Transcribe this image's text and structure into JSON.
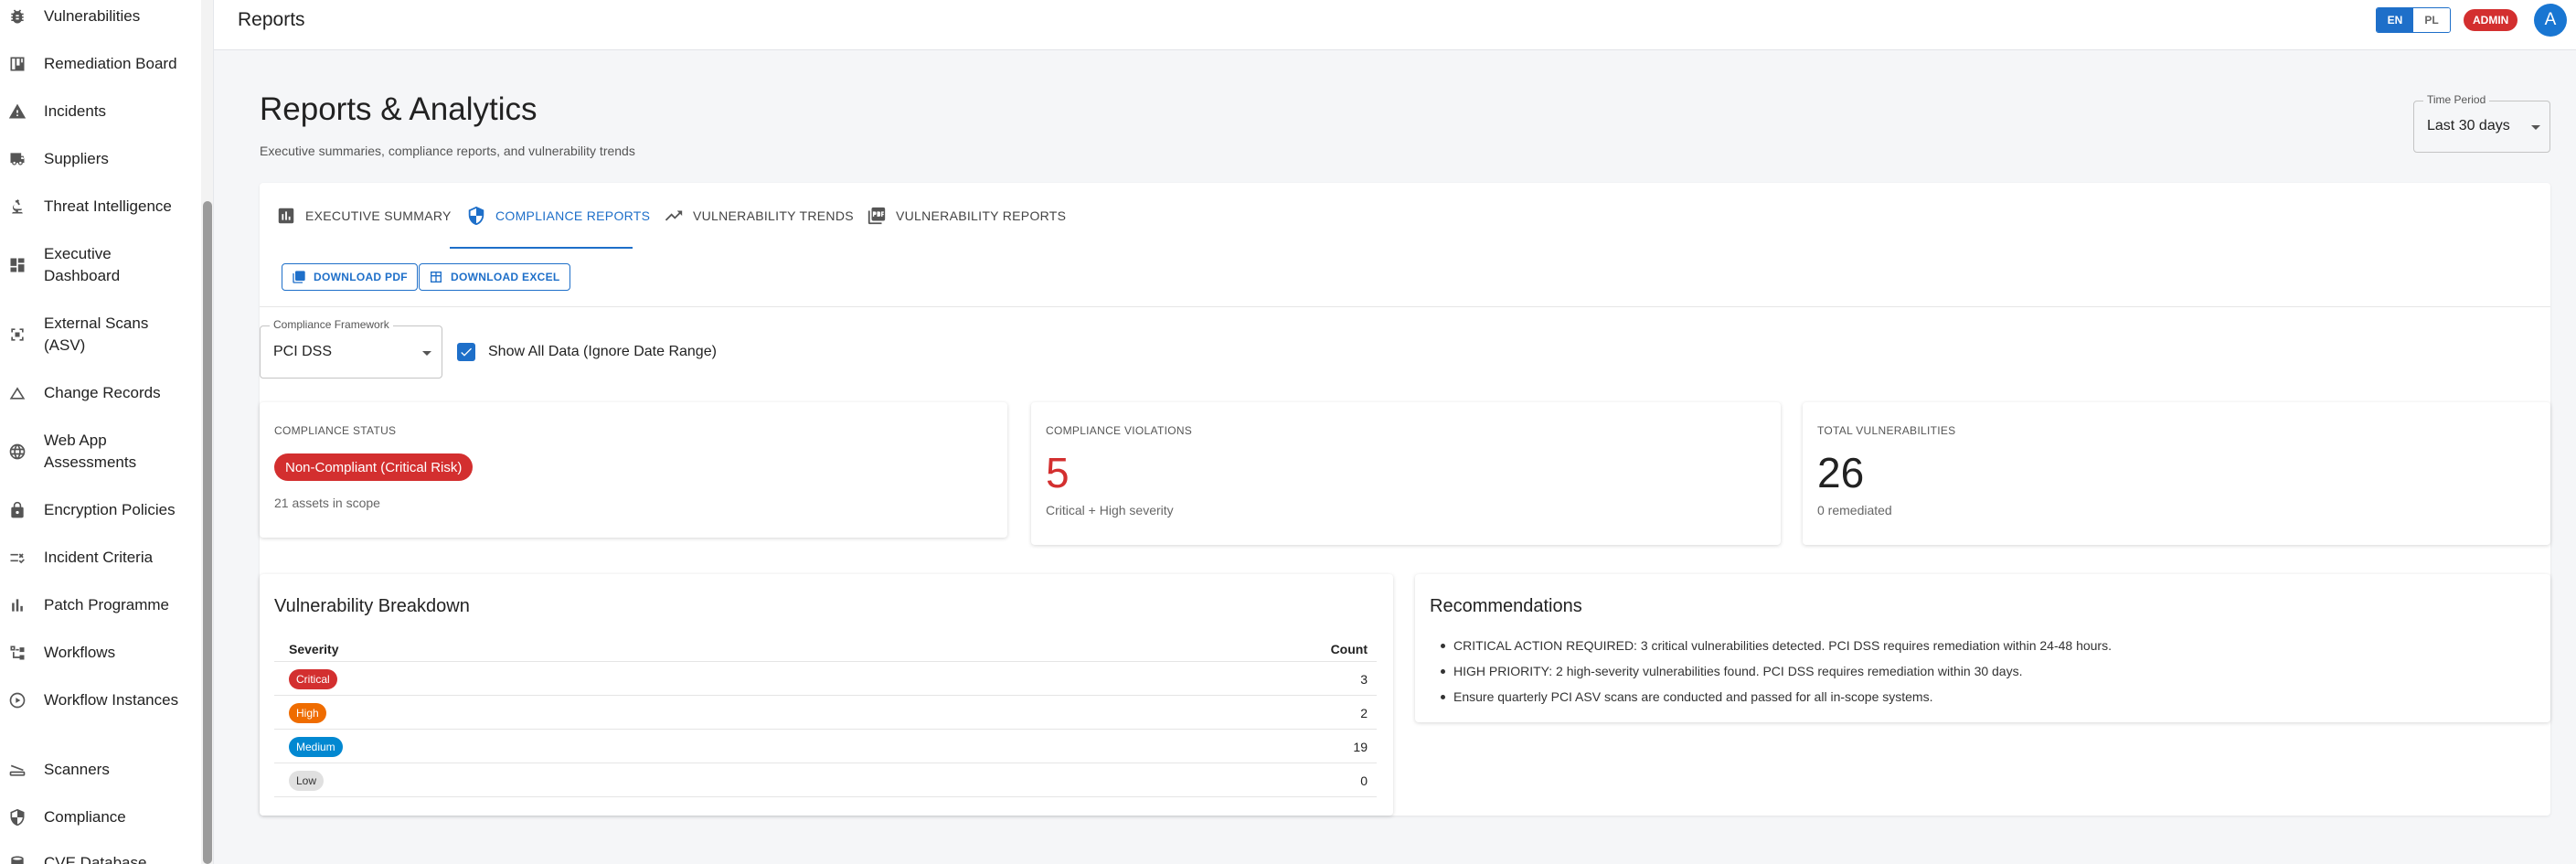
{
  "sidebar": {
    "items": [
      {
        "label": "Vulnerabilities",
        "icon": "bug-icon"
      },
      {
        "label": "Remediation Board",
        "icon": "board-icon"
      },
      {
        "label": "Incidents",
        "icon": "warning-icon"
      },
      {
        "label": "Suppliers",
        "icon": "truck-icon"
      },
      {
        "label": "Threat Intelligence",
        "icon": "microscope-icon"
      },
      {
        "label": "Executive Dashboard",
        "icon": "dashboard-icon"
      },
      {
        "label": "External Scans (ASV)",
        "icon": "radar-icon"
      },
      {
        "label": "Change Records",
        "icon": "triangle-icon"
      },
      {
        "label": "Web App Assessments",
        "icon": "globe-icon"
      },
      {
        "label": "Encryption Policies",
        "icon": "lock-icon"
      },
      {
        "label": "Incident Criteria",
        "icon": "rule-icon"
      },
      {
        "label": "Patch Programme",
        "icon": "bar-chart-icon"
      },
      {
        "label": "Workflows",
        "icon": "workflow-icon"
      },
      {
        "label": "Workflow Instances",
        "icon": "play-circle-icon"
      },
      {
        "label": "Scanners",
        "icon": "scanner-icon"
      },
      {
        "label": "Compliance",
        "icon": "shield-icon"
      },
      {
        "label": "CVE Database",
        "icon": "database-icon"
      }
    ]
  },
  "topbar": {
    "title": "Reports",
    "lang_en": "EN",
    "lang_pl": "PL",
    "role_badge": "ADMIN",
    "avatar_letter": "A"
  },
  "page": {
    "title": "Reports & Analytics",
    "subtitle": "Executive summaries, compliance reports, and vulnerability trends",
    "time_period_label": "Time Period",
    "time_period_value": "Last 30 days"
  },
  "tabs": [
    {
      "label": "EXECUTIVE SUMMARY",
      "icon": "bar-chart-icon",
      "active": false
    },
    {
      "label": "COMPLIANCE REPORTS",
      "icon": "shield-icon",
      "active": true
    },
    {
      "label": "VULNERABILITY TRENDS",
      "icon": "trending-up-icon",
      "active": false
    },
    {
      "label": "VULNERABILITY REPORTS",
      "icon": "pdf-icon",
      "active": false
    }
  ],
  "actions": {
    "download_pdf": "DOWNLOAD PDF",
    "download_excel": "DOWNLOAD EXCEL"
  },
  "filters": {
    "framework_label": "Compliance Framework",
    "framework_value": "PCI DSS",
    "show_all_label": "Show All Data (Ignore Date Range)",
    "show_all_checked": true
  },
  "stats": {
    "compliance_status": {
      "label": "COMPLIANCE STATUS",
      "status": "Non-Compliant (Critical Risk)",
      "sub": "21 assets in scope"
    },
    "violations": {
      "label": "COMPLIANCE VIOLATIONS",
      "value": "5",
      "sub": "Critical + High severity"
    },
    "total_vulns": {
      "label": "TOTAL VULNERABILITIES",
      "value": "26",
      "sub": "0 remediated"
    }
  },
  "breakdown": {
    "title": "Vulnerability Breakdown",
    "col_severity": "Severity",
    "col_count": "Count",
    "rows": [
      {
        "severity": "Critical",
        "count": "3",
        "color": "#d32f2f",
        "text_color": "#ffffff"
      },
      {
        "severity": "High",
        "count": "2",
        "color": "#ef6c00",
        "text_color": "#ffffff"
      },
      {
        "severity": "Medium",
        "count": "19",
        "color": "#0288d1",
        "text_color": "#ffffff"
      },
      {
        "severity": "Low",
        "count": "0",
        "color": "#e0e0e0",
        "text_color": "#333333"
      }
    ]
  },
  "recommendations": {
    "title": "Recommendations",
    "items": [
      "CRITICAL ACTION REQUIRED: 3 critical vulnerabilities detected. PCI DSS requires remediation within 24-48 hours.",
      "HIGH PRIORITY: 2 high-severity vulnerabilities found. PCI DSS requires remediation within 30 days.",
      "Ensure quarterly PCI ASV scans are conducted and passed for all in-scope systems."
    ]
  },
  "colors": {
    "accent": "#1e6fc9",
    "danger": "#d32f2f"
  }
}
